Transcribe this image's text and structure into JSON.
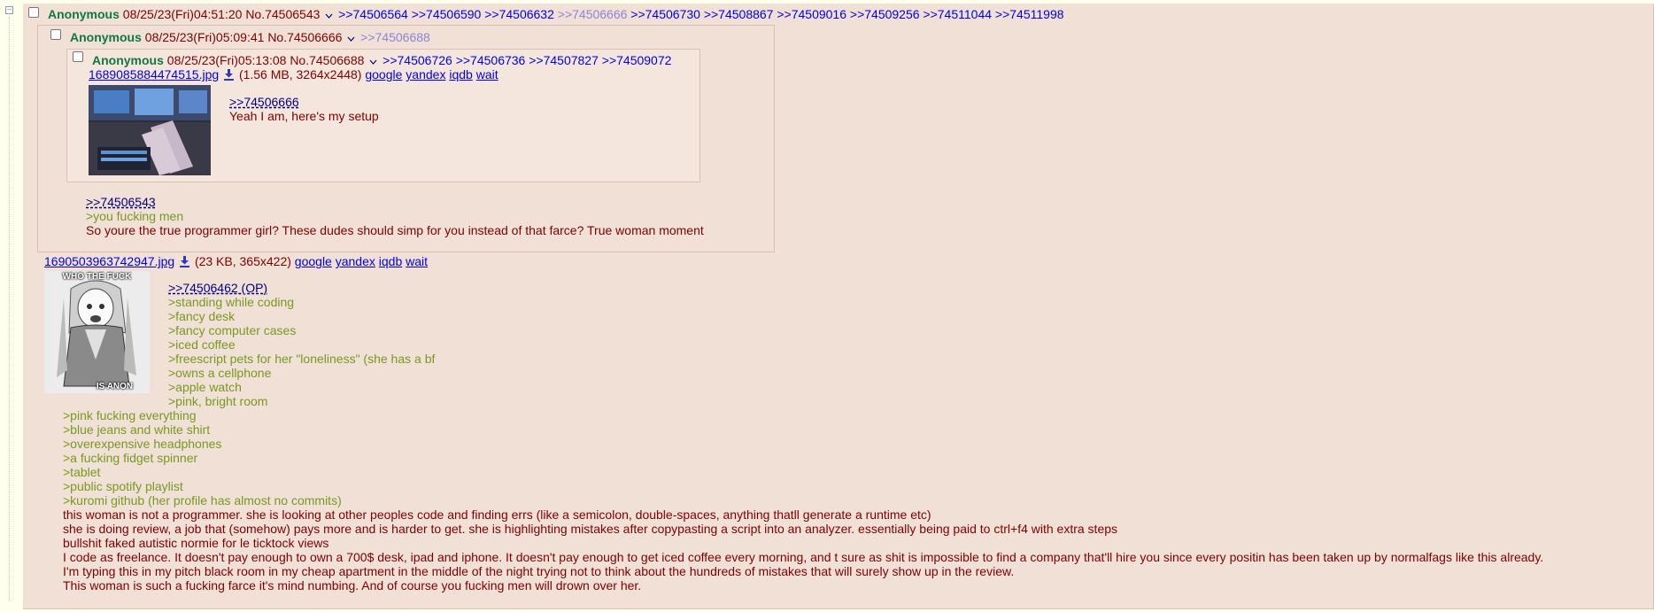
{
  "main_post": {
    "name": "Anonymous",
    "datetime": "08/25/23(Fri)04:51:20",
    "number": "No.74506543",
    "backlinks": [
      ">>74506564",
      ">>74506590",
      ">>74506632",
      ">>74506666",
      ">>74506730",
      ">>74508867",
      ">>74509016",
      ">>74509256",
      ">>74511044",
      ">>74511998"
    ],
    "file": {
      "filename": "1690503963742947.jpg",
      "info": "(23 KB, 365x422)",
      "search_links": [
        "google",
        "yandex",
        "iqdb",
        "wait"
      ],
      "thumb_caption_top": "WHO THE FUCK",
      "thumb_caption_bottom": "IS ANON"
    },
    "quote_link": ">>74506462 (OP)",
    "lines": [
      {
        "text": ">standing while coding",
        "green": true
      },
      {
        "text": ">fancy desk",
        "green": true
      },
      {
        "text": ">fancy computer cases",
        "green": true
      },
      {
        "text": ">iced coffee",
        "green": true
      },
      {
        "text": ">freescript pets for her \"loneliness\" (she has a bf",
        "green": true
      },
      {
        "text": ">owns a cellphone",
        "green": true
      },
      {
        "text": ">apple watch",
        "green": true
      },
      {
        "text": ">pink, bright room",
        "green": true
      },
      {
        "text": ">pink fucking everything",
        "green": true
      },
      {
        "text": ">blue jeans and white shirt",
        "green": true
      },
      {
        "text": ">overexpensive headphones",
        "green": true
      },
      {
        "text": ">a fucking fidget spinner",
        "green": true
      },
      {
        "text": ">tablet",
        "green": true
      },
      {
        "text": ">public spotify playlist",
        "green": true
      },
      {
        "text": ">kuromi github (her profile has almost no commits)",
        "green": true
      },
      {
        "text": "this woman is not a programmer. she is looking at other peoples code and finding errs (like a semicolon, double-spaces, anything thatll generate a runtime etc)",
        "green": false
      },
      {
        "text": "she is doing review, a job that (somehow) pays more and is harder to get. she is highlighting mistakes after copypasting a script into an analyzer. essentially being paid to ctrl+f4 with extra steps",
        "green": false
      },
      {
        "text": "bullshit faked autistic normie for le ticktock views",
        "green": false
      },
      {
        "text": "I code as freelance. It doesn't pay enough to own a 700$ desk, ipad and iphone. It doesn't pay enough to get iced coffee every morning, and t sure as shit is impossible to find a company that'll hire you since every positin has been taken up by normalfags like this already.",
        "green": false
      },
      {
        "text": "I'm typing this in my pitch black room in my cheap apartment in the middle of the night trying not to think about the hundreds of mistakes that will surely show up in the review.",
        "green": false
      },
      {
        "text": "This woman is such a fucking farce it's mind numbing. And of course you fucking men will drown over her.",
        "green": false
      }
    ]
  },
  "inline_post_1": {
    "name": "Anonymous",
    "datetime": "08/25/23(Fri)05:09:41",
    "number": "No.74506666",
    "backlink": ">>74506688",
    "quote_link": ">>74506543",
    "lines": [
      {
        "text": ">you fucking men",
        "green": true
      },
      {
        "text": "So youre the true programmer girl? These dudes should simp for you instead of that farce? True woman moment",
        "green": false
      }
    ]
  },
  "inline_post_2": {
    "name": "Anonymous",
    "datetime": "08/25/23(Fri)05:13:08",
    "number": "No.74506688",
    "backlinks": [
      ">>74506726",
      ">>74506736",
      ">>74507827",
      ">>74509072"
    ],
    "file": {
      "filename": "1689085884474515.jpg",
      "info": "(1.56 MB, 3264x2448)",
      "search_links": [
        "google",
        "yandex",
        "iqdb",
        "wait"
      ]
    },
    "quote_link": ">>74506666",
    "text": "Yeah I am, here's my setup"
  },
  "colors": {
    "background": "#ffffee",
    "reply_bg": "#f0e0d6",
    "name_green": "#117743",
    "greentext": "#789922",
    "link_blue": "#0000ee",
    "text_maroon": "#800000"
  },
  "icons": {
    "collapse": "minus-box-icon",
    "menu_arrow": "chevron-down-icon",
    "download": "download-icon"
  },
  "collapse_glyph": "−"
}
